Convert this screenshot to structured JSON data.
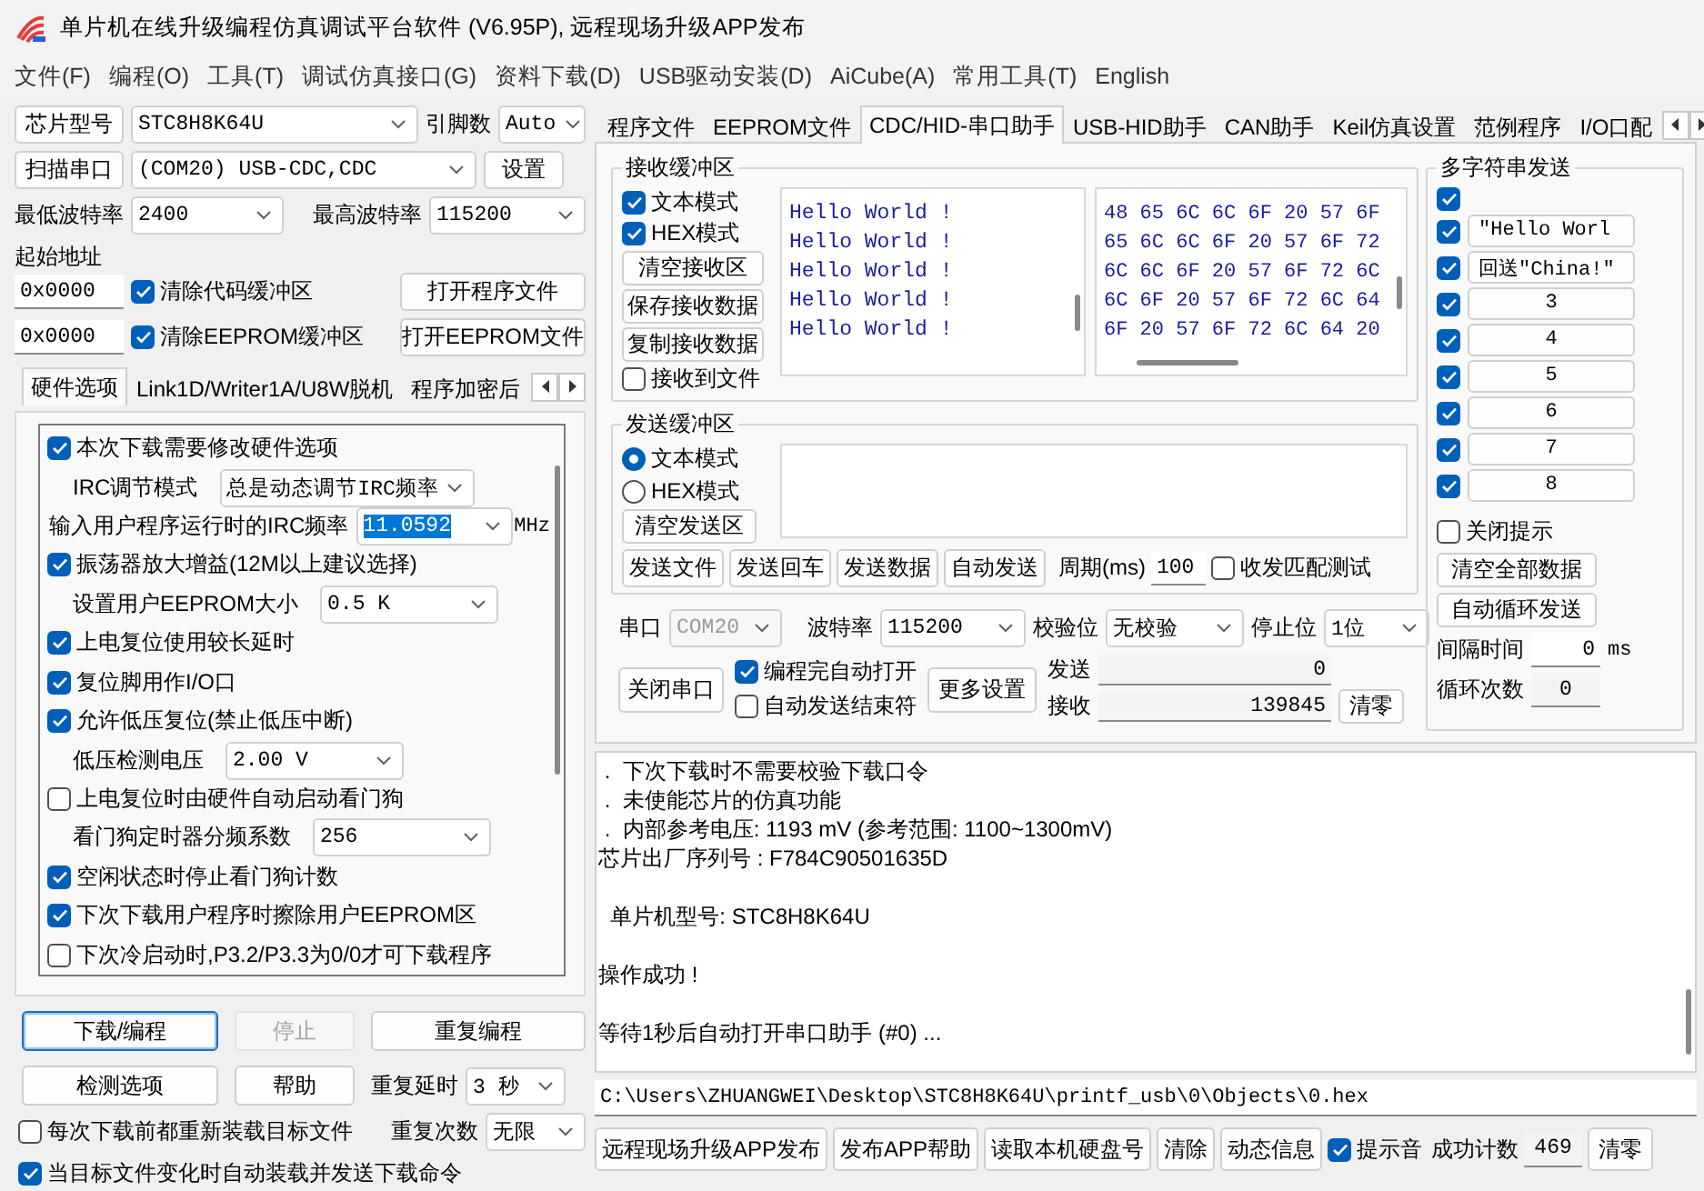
{
  "window": {
    "title": "单片机在线升级编程仿真调试平台软件 (V6.95P), 远程现场升级APP发布"
  },
  "menu": [
    "文件(F)",
    "编程(O)",
    "工具(T)",
    "调试仿真接口(G)",
    "资料下载(D)",
    "USB驱动安装(D)",
    "AiCube(A)",
    "常用工具(T)",
    "English"
  ],
  "left": {
    "chip": {
      "button": "芯片型号",
      "value": "STC8H8K64U",
      "pins_label": "引脚数",
      "pins": "Auto"
    },
    "port": {
      "button": "扫描串口",
      "value": "(COM20) USB-CDC,CDC",
      "settings_button": "设置"
    },
    "baud": {
      "min_label": "最低波特率",
      "min": "2400",
      "max_label": "最高波特率",
      "max": "115200"
    },
    "start_address": {
      "label": "起始地址",
      "code_address": "0x0000",
      "clear_code": {
        "label": "清除代码缓冲区",
        "checked": true
      },
      "open_program": "打开程序文件",
      "eeprom_address": "0x0000",
      "clear_eeprom": {
        "label": "清除EEPROM缓冲区",
        "checked": true
      },
      "open_eeprom": "打开EEPROM文件"
    },
    "tabs": [
      {
        "label": "硬件选项",
        "selected": true
      },
      {
        "label": "Link1D/Writer1A/U8W脱机",
        "selected": false
      },
      {
        "label": "程序加密后",
        "selected": false
      }
    ],
    "options": [
      {
        "kind": "check",
        "label": "本次下载需要修改硬件选项",
        "checked": true
      },
      {
        "kind": "select",
        "label": "IRC调节模式",
        "value": "总是动态调节IRC频率"
      },
      {
        "kind": "freq",
        "label": "输入用户程序运行时的IRC频率",
        "value": "11.0592",
        "value_selected": true,
        "unit": "MHz"
      },
      {
        "kind": "check",
        "label": "振荡器放大增益(12M以上建议选择)",
        "checked": true
      },
      {
        "kind": "select",
        "label": "设置用户EEPROM大小",
        "value": "0.5 K"
      },
      {
        "kind": "check",
        "label": "上电复位使用较长延时",
        "checked": true
      },
      {
        "kind": "check",
        "label": "复位脚用作I/O口",
        "checked": true
      },
      {
        "kind": "check",
        "label": "允许低压复位(禁止低压中断)",
        "checked": true
      },
      {
        "kind": "select",
        "label": "低压检测电压",
        "value": "2.00 V"
      },
      {
        "kind": "check",
        "label": "上电复位时由硬件自动启动看门狗",
        "checked": false
      },
      {
        "kind": "select",
        "label": "看门狗定时器分频系数",
        "value": "256"
      },
      {
        "kind": "check",
        "label": "空闲状态时停止看门狗计数",
        "checked": true
      },
      {
        "kind": "check",
        "label": "下次下载用户程序时擦除用户EEPROM区",
        "checked": true
      },
      {
        "kind": "check",
        "label": "下次冷启动时,P3.2/P3.3为0/0才可下载程序",
        "checked": false
      }
    ],
    "actions": [
      {
        "label": "下载/编程",
        "disabled": false,
        "focused": true
      },
      {
        "label": "停止",
        "disabled": true,
        "focused": false
      },
      {
        "label": "重复编程",
        "disabled": false,
        "focused": false
      },
      {
        "label": "检测选项",
        "disabled": false,
        "focused": false
      },
      {
        "label": "帮助",
        "disabled": false,
        "focused": false
      }
    ],
    "repeat_delay": {
      "label": "重复延时",
      "value": "3 秒"
    },
    "repeat_count": {
      "label": "重复次数",
      "value": "无限"
    },
    "reload_each": {
      "label": "每次下载前都重新装载目标文件",
      "checked": false
    },
    "auto_send": {
      "label": "当目标文件变化时自动装载并发送下载命令",
      "checked": true
    }
  },
  "right": {
    "tabs": [
      {
        "label": "程序文件",
        "selected": false
      },
      {
        "label": "EEPROM文件",
        "selected": false
      },
      {
        "label": "CDC/HID-串口助手",
        "selected": true
      },
      {
        "label": "USB-HID助手",
        "selected": false
      },
      {
        "label": "CAN助手",
        "selected": false
      },
      {
        "label": "Keil仿真设置",
        "selected": false
      },
      {
        "label": "范例程序",
        "selected": false
      },
      {
        "label": "I/O口配",
        "selected": false
      }
    ],
    "receive": {
      "title": "接收缓冲区",
      "text_mode": {
        "label": "文本模式",
        "checked": true
      },
      "hex_mode": {
        "label": "HEX模式",
        "checked": true
      },
      "buttons": [
        "清空接收区",
        "保存接收数据",
        "复制接收数据"
      ],
      "to_file": {
        "label": "接收到文件",
        "checked": false
      },
      "text_lines": [
        "Hello World !",
        "Hello World !",
        "Hello World !",
        "Hello World !",
        "Hello World !"
      ],
      "hex_lines": [
        "48 65 6C 6C 6F 20 57 6F",
        "65 6C 6C 6F 20 57 6F 72",
        "6C 6C 6F 20 57 6F 72 6C",
        "6C 6F 20 57 6F 72 6C 64",
        "6F 20 57 6F 72 6C 64 20"
      ]
    },
    "send": {
      "title": "发送缓冲区",
      "modes": [
        {
          "label": "文本模式",
          "selected": true
        },
        {
          "label": "HEX模式",
          "selected": false
        }
      ],
      "clear": "清空发送区",
      "buttons": [
        "发送文件",
        "发送回车",
        "发送数据",
        "自动发送"
      ],
      "period_label": "周期(ms)",
      "period": "100",
      "match_test": {
        "label": "收发匹配测试",
        "checked": false
      }
    },
    "serial": {
      "port_label": "串口",
      "port": "COM20",
      "port_disabled": true,
      "baud_label": "波特率",
      "baud": "115200",
      "parity_label": "校验位",
      "parity": "无校验",
      "stop_label": "停止位",
      "stop": "1位",
      "close_button": "关闭串口",
      "auto_open": {
        "label": "编程完自动打开",
        "checked": true
      },
      "auto_end": {
        "label": "自动发送结束符",
        "checked": false
      },
      "more_button": "更多设置",
      "sent_label": "发送",
      "sent": "0",
      "received_label": "接收",
      "received": "139845",
      "reset_button": "清零"
    },
    "multi": {
      "title": "多字符串发送",
      "all_checked": true,
      "items": [
        {
          "label": "\"Hello Worl",
          "checked": true
        },
        {
          "label": "回送\"China!\"",
          "checked": true
        },
        {
          "label": "3",
          "checked": true
        },
        {
          "label": "4",
          "checked": true
        },
        {
          "label": "5",
          "checked": true
        },
        {
          "label": "6",
          "checked": true
        },
        {
          "label": "7",
          "checked": true
        },
        {
          "label": "8",
          "checked": true
        }
      ],
      "close_tips": {
        "label": "关闭提示",
        "checked": false
      },
      "clear_all": "清空全部数据",
      "auto_loop": "自动循环发送",
      "interval_label": "间隔时间",
      "interval": "0",
      "interval_unit": "ms",
      "loop_label": "循环次数",
      "loop": "0"
    }
  },
  "log": {
    "paragraphs": [
      [
        " .  下次下载时不需要校验下载口令",
        " .  未使能芯片的仿真功能",
        " .  内部参考电压: 1193 mV (参考范围: 1100~1300mV)",
        "芯片出厂序列号 : F784C90501635D"
      ],
      [
        "  单片机型号: STC8H8K64U"
      ],
      [
        "操作成功 !"
      ],
      [
        "等待1秒后自动打开串口助手 (#0) ..."
      ]
    ]
  },
  "path": "C:\\Users\\ZHUANGWEI\\Desktop\\STC8H8K64U\\printf_usb\\0\\Objects\\0.hex",
  "bottom": {
    "buttons": [
      "远程现场升级APP发布",
      "发布APP帮助",
      "读取本机硬盘号",
      "清除",
      "动态信息"
    ],
    "beep": {
      "label": "提示音",
      "checked": true
    },
    "count_label": "成功计数",
    "count": "469",
    "reset_button": "清零"
  }
}
